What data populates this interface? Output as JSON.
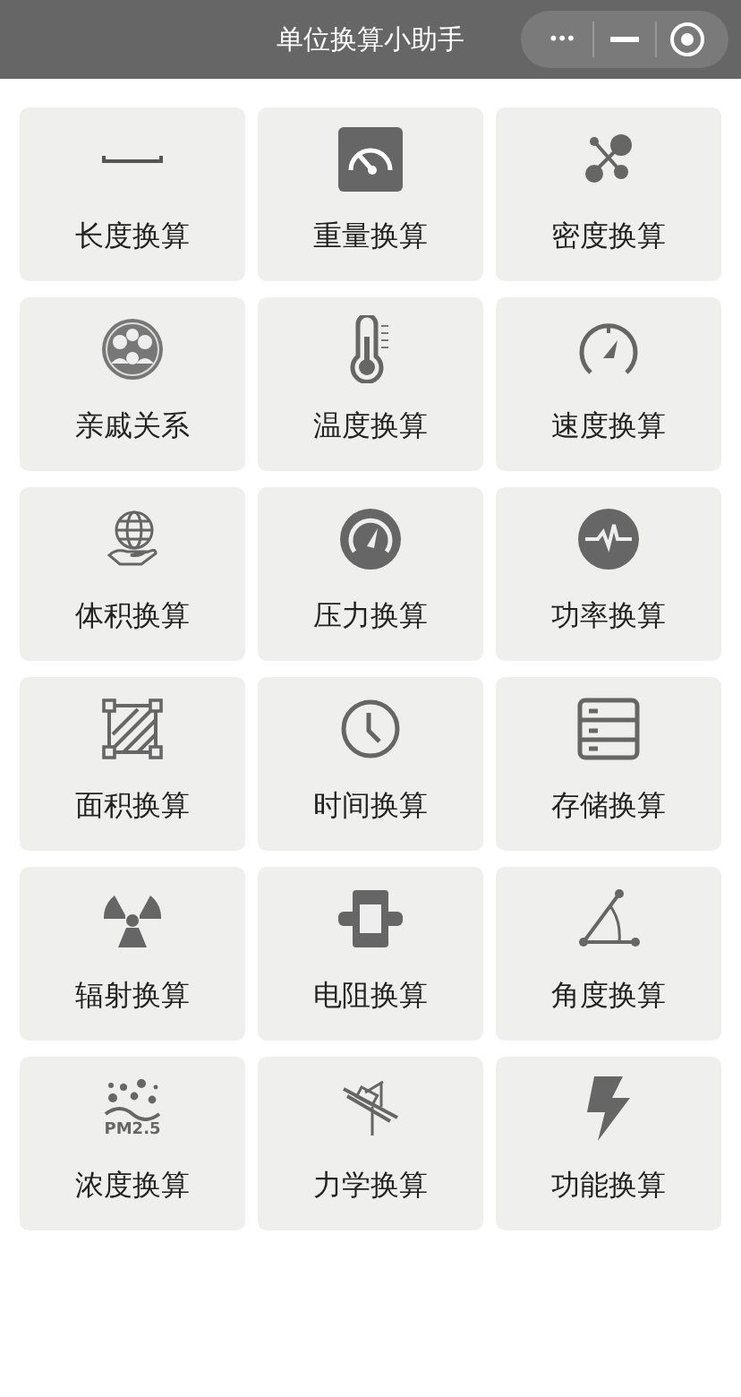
{
  "window": {
    "title": "单位换算小助手"
  },
  "capsule": {
    "more": "•••"
  },
  "tiles": [
    {
      "label": "长度换算",
      "kind": "ruler"
    },
    {
      "label": "重量换算",
      "kind": "scale"
    },
    {
      "label": "密度换算",
      "kind": "molecule"
    },
    {
      "label": "亲戚关系",
      "kind": "family"
    },
    {
      "label": "温度换算",
      "kind": "thermometer"
    },
    {
      "label": "速度换算",
      "kind": "speedometer"
    },
    {
      "label": "体积换算",
      "kind": "globe"
    },
    {
      "label": "压力换算",
      "kind": "gauge"
    },
    {
      "label": "功率换算",
      "kind": "pulse"
    },
    {
      "label": "面积换算",
      "kind": "area"
    },
    {
      "label": "时间换算",
      "kind": "clock"
    },
    {
      "label": "存储换算",
      "kind": "storage"
    },
    {
      "label": "辐射换算",
      "kind": "radiation"
    },
    {
      "label": "电阻换算",
      "kind": "resistor"
    },
    {
      "label": "角度换算",
      "kind": "angle"
    },
    {
      "label": "浓度换算",
      "kind": "particles",
      "icon_text": "PM2.5"
    },
    {
      "label": "力学换算",
      "kind": "mechanics"
    },
    {
      "label": "功能换算",
      "kind": "lightning"
    }
  ]
}
